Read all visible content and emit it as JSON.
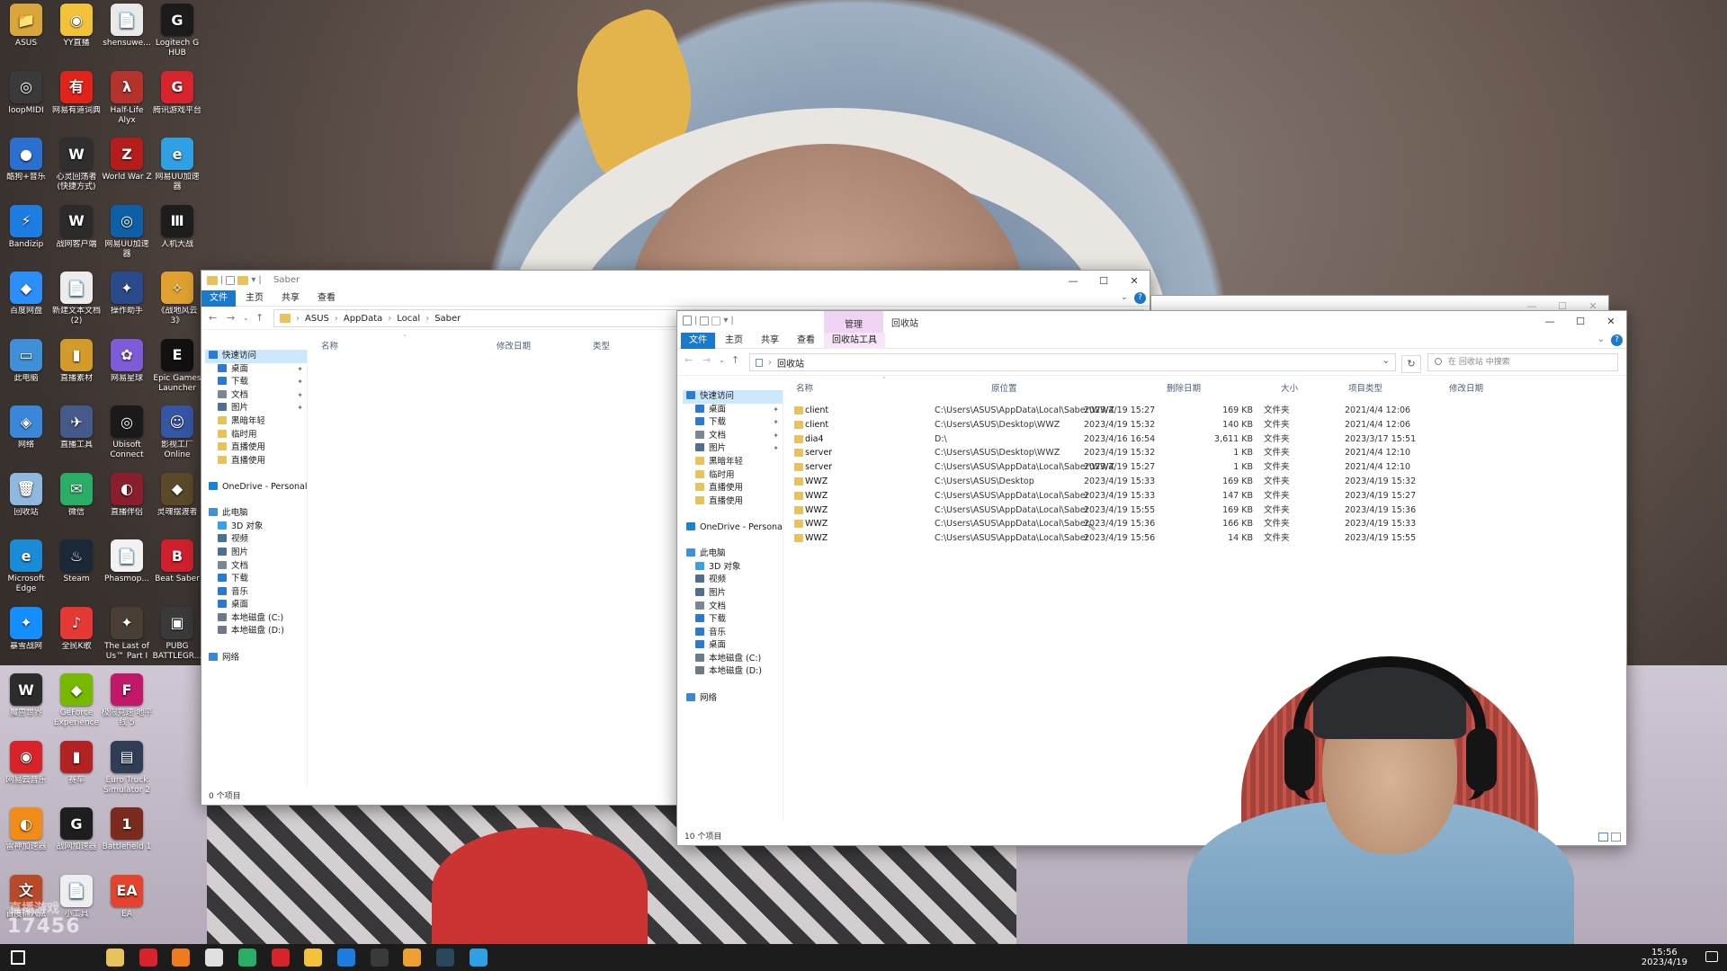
{
  "desktop": {
    "icons": [
      {
        "label": "ASUS",
        "glyph": "📁",
        "color": "#d9a63b"
      },
      {
        "label": "YY直播",
        "glyph": "◉",
        "color": "#f3c13a"
      },
      {
        "label": "shensuwe...",
        "glyph": "📄",
        "color": "#e9e9e9"
      },
      {
        "label": "Logitech G HUB",
        "glyph": "G",
        "color": "#1b1b1b"
      },
      {
        "label": "loopMIDI",
        "glyph": "◎",
        "color": "#3a3a3a"
      },
      {
        "label": "网易有道词典",
        "glyph": "有",
        "color": "#e2231a"
      },
      {
        "label": "Half-Life Alyx",
        "glyph": "λ",
        "color": "#b5332c"
      },
      {
        "label": "腾讯游戏平台",
        "glyph": "G",
        "color": "#d8242d"
      },
      {
        "label": "酷狗+音乐",
        "glyph": "●",
        "color": "#2b6fd1"
      },
      {
        "label": "心灵回荡者 (快捷方式)",
        "glyph": "W",
        "color": "#2f2f2f"
      },
      {
        "label": "World War Z",
        "glyph": "Z",
        "color": "#b51d1d"
      },
      {
        "label": "网易UU加速器",
        "glyph": "e",
        "color": "#2fa0e3"
      },
      {
        "label": "Bandizip",
        "glyph": "⚡",
        "color": "#1e7de2"
      },
      {
        "label": "战网客户端",
        "glyph": "W",
        "color": "#2b2b2b"
      },
      {
        "label": "网易UU加速器",
        "glyph": "◎",
        "color": "#0f5ea8"
      },
      {
        "label": "人机大战",
        "glyph": "Ⅲ",
        "color": "#1d1d1d"
      },
      {
        "label": "百度网盘",
        "glyph": "◆",
        "color": "#2c8ef8"
      },
      {
        "label": "新建文本文档 (2)",
        "glyph": "📄",
        "color": "#ececec"
      },
      {
        "label": "操作助手",
        "glyph": "✦",
        "color": "#2a4a8c"
      },
      {
        "label": "《战地风云 3》",
        "glyph": "✧",
        "color": "#e0a12e"
      },
      {
        "label": "此电脑",
        "glyph": "▭",
        "color": "#3f8fd9"
      },
      {
        "label": "直播素材",
        "glyph": "▮",
        "color": "#d39b2c"
      },
      {
        "label": "网易星球",
        "glyph": "✿",
        "color": "#7e5bd8"
      },
      {
        "label": "Epic Games Launcher",
        "glyph": "E",
        "color": "#111111"
      },
      {
        "label": "网络",
        "glyph": "◈",
        "color": "#3a86d8"
      },
      {
        "label": "直播工具",
        "glyph": "✈",
        "color": "#455a8a"
      },
      {
        "label": "Ubisoft Connect",
        "glyph": "◎",
        "color": "#1a1a1a"
      },
      {
        "label": "影视工厂 Online",
        "glyph": "☺",
        "color": "#3555a5"
      },
      {
        "label": "回收站",
        "glyph": "🗑",
        "color": "#8fb8e0"
      },
      {
        "label": "微信",
        "glyph": "✉",
        "color": "#2aae67"
      },
      {
        "label": "直播伴侣",
        "glyph": "◐",
        "color": "#8b1e2d"
      },
      {
        "label": "灵魂摆渡者",
        "glyph": "◆",
        "color": "#5a4a2a"
      },
      {
        "label": "Microsoft Edge",
        "glyph": "e",
        "color": "#1a8bd6"
      },
      {
        "label": "Steam",
        "glyph": "♨",
        "color": "#1b2838"
      },
      {
        "label": "Phasmop...",
        "glyph": "📄",
        "color": "#f2f2f2"
      },
      {
        "label": "Beat Saber",
        "glyph": "B",
        "color": "#d0202f"
      },
      {
        "label": "暴雪战网",
        "glyph": "✦",
        "color": "#148eff"
      },
      {
        "label": "全民K歌",
        "glyph": "♪",
        "color": "#e53935"
      },
      {
        "label": "The Last of Us™ Part I",
        "glyph": "✦",
        "color": "#4a3f35"
      },
      {
        "label": "PUBG BATTLEGR...",
        "glyph": "▣",
        "color": "#3a3a3a"
      },
      {
        "label": "魔兽世界",
        "glyph": "W",
        "color": "#2c2c2c"
      },
      {
        "label": "GeForce Experience",
        "glyph": "◆",
        "color": "#76b900"
      },
      {
        "label": "极限竞速 地平线 5",
        "glyph": "F",
        "color": "#c2186b"
      },
      {
        "label": "",
        "glyph": "",
        "color": "transparent"
      },
      {
        "label": "网易云音乐",
        "glyph": "◉",
        "color": "#d8232a"
      },
      {
        "label": "赛车",
        "glyph": "▮",
        "color": "#b32222"
      },
      {
        "label": "Euro Truck Simulator 2",
        "glyph": "▤",
        "color": "#2f3d55"
      },
      {
        "label": "",
        "glyph": "",
        "color": "transparent"
      },
      {
        "label": "雷神加速器",
        "glyph": "◐",
        "color": "#f18b1a"
      },
      {
        "label": "战网加速器",
        "glyph": "G",
        "color": "#1e1e1e"
      },
      {
        "label": "Battlefield 1",
        "glyph": "1",
        "color": "#7a2b1d"
      },
      {
        "label": "",
        "glyph": "",
        "color": "transparent"
      },
      {
        "label": "百度输入法",
        "glyph": "文",
        "color": "#b84a2a"
      },
      {
        "label": "小工具",
        "glyph": "📄",
        "color": "#eeeeee"
      },
      {
        "label": "EA",
        "glyph": "EA",
        "color": "#e4432d"
      }
    ]
  },
  "saber_window": {
    "title": "Saber",
    "ribbon": [
      "文件",
      "主页",
      "共享",
      "查看"
    ],
    "address": [
      "ASUS",
      "AppData",
      "Local",
      "Saber"
    ],
    "columns": [
      "名称",
      "修改日期",
      "类型"
    ],
    "nav": [
      {
        "label": "快速访问",
        "icon": "star-icon",
        "color": "#2a7ad8",
        "indent": 0,
        "sel": true,
        "pin": false
      },
      {
        "label": "桌面",
        "icon": "desktop-icon",
        "color": "#2b79d0",
        "indent": 1,
        "pin": true
      },
      {
        "label": "下载",
        "icon": "download-icon",
        "color": "#2b79d0",
        "indent": 1,
        "pin": true
      },
      {
        "label": "文档",
        "icon": "document-icon",
        "color": "#7a8795",
        "indent": 1,
        "pin": true
      },
      {
        "label": "图片",
        "icon": "pictures-icon",
        "color": "#4f6f90",
        "indent": 1,
        "pin": true
      },
      {
        "label": "黑暗年轻",
        "icon": "folder-icon",
        "color": "#e8c25a",
        "indent": 1,
        "pin": false
      },
      {
        "label": "临时用",
        "icon": "folder-icon",
        "color": "#e8c25a",
        "indent": 1,
        "pin": false
      },
      {
        "label": "直播使用",
        "icon": "folder-icon",
        "color": "#e8c25a",
        "indent": 1,
        "pin": false
      },
      {
        "label": "直播使用",
        "icon": "folder-icon",
        "color": "#e8c25a",
        "indent": 1,
        "pin": false
      },
      {
        "label": "",
        "icon": "",
        "color": "transparent",
        "indent": 0,
        "pin": false
      },
      {
        "label": "OneDrive - Personal",
        "icon": "cloud-icon",
        "color": "#1a80d8",
        "indent": 0,
        "pin": false
      },
      {
        "label": "",
        "icon": "",
        "color": "transparent",
        "indent": 0,
        "pin": false
      },
      {
        "label": "此电脑",
        "icon": "pc-icon",
        "color": "#3f8fd9",
        "indent": 0,
        "pin": false
      },
      {
        "label": "3D 对象",
        "icon": "3d-objects-icon",
        "color": "#3aa0e0",
        "indent": 1,
        "pin": false
      },
      {
        "label": "视频",
        "icon": "video-icon",
        "color": "#4f6f90",
        "indent": 1,
        "pin": false
      },
      {
        "label": "图片",
        "icon": "pictures-icon",
        "color": "#4f6f90",
        "indent": 1,
        "pin": false
      },
      {
        "label": "文档",
        "icon": "document-icon",
        "color": "#7a8795",
        "indent": 1,
        "pin": false
      },
      {
        "label": "下载",
        "icon": "download-icon",
        "color": "#2b79d0",
        "indent": 1,
        "pin": false
      },
      {
        "label": "音乐",
        "icon": "music-icon",
        "color": "#2b79d0",
        "indent": 1,
        "pin": false
      },
      {
        "label": "桌面",
        "icon": "desktop-icon",
        "color": "#2b79d0",
        "indent": 1,
        "pin": false
      },
      {
        "label": "本地磁盘 (C:)",
        "icon": "drive-icon",
        "color": "#6d7b89",
        "indent": 1,
        "pin": false
      },
      {
        "label": "本地磁盘 (D:)",
        "icon": "drive-icon",
        "color": "#6d7b89",
        "indent": 1,
        "pin": false
      },
      {
        "label": "",
        "icon": "",
        "color": "transparent",
        "indent": 0,
        "pin": false
      },
      {
        "label": "网络",
        "icon": "network-icon",
        "color": "#3a86d8",
        "indent": 0,
        "pin": false
      }
    ],
    "status": "0 个项目"
  },
  "recycle_window": {
    "title": "回收站",
    "manage_label": "管理",
    "ribbon": [
      "文件",
      "主页",
      "共享",
      "查看",
      "回收站工具"
    ],
    "address": "回收站",
    "search_placeholder": "在 回收站 中搜索",
    "columns": [
      "名称",
      "原位置",
      "删除日期",
      "大小",
      "项目类型",
      "修改日期"
    ],
    "rows": [
      {
        "name": "client",
        "orig": "C:\\Users\\ASUS\\AppData\\Local\\Saber\\WWZ",
        "deleted": "2023/4/19 15:27",
        "size": "169 KB",
        "type": "文件夹",
        "modified": "2021/4/4 12:06"
      },
      {
        "name": "client",
        "orig": "C:\\Users\\ASUS\\Desktop\\WWZ",
        "deleted": "2023/4/19 15:32",
        "size": "140 KB",
        "type": "文件夹",
        "modified": "2021/4/4 12:06"
      },
      {
        "name": "dia4",
        "orig": "D:\\",
        "deleted": "2023/4/16 16:54",
        "size": "3,611 KB",
        "type": "文件夹",
        "modified": "2023/3/17 15:51"
      },
      {
        "name": "server",
        "orig": "C:\\Users\\ASUS\\Desktop\\WWZ",
        "deleted": "2023/4/19 15:32",
        "size": "1 KB",
        "type": "文件夹",
        "modified": "2021/4/4 12:10"
      },
      {
        "name": "server",
        "orig": "C:\\Users\\ASUS\\AppData\\Local\\Saber\\WWZ",
        "deleted": "2023/4/19 15:27",
        "size": "1 KB",
        "type": "文件夹",
        "modified": "2021/4/4 12:10"
      },
      {
        "name": "WWZ",
        "orig": "C:\\Users\\ASUS\\Desktop",
        "deleted": "2023/4/19 15:33",
        "size": "169 KB",
        "type": "文件夹",
        "modified": "2023/4/19 15:32"
      },
      {
        "name": "WWZ",
        "orig": "C:\\Users\\ASUS\\AppData\\Local\\Saber",
        "deleted": "2023/4/19 15:33",
        "size": "147 KB",
        "type": "文件夹",
        "modified": "2023/4/19 15:27"
      },
      {
        "name": "WWZ",
        "orig": "C:\\Users\\ASUS\\AppData\\Local\\Saber",
        "deleted": "2023/4/19 15:55",
        "size": "169 KB",
        "type": "文件夹",
        "modified": "2023/4/19 15:36"
      },
      {
        "name": "WWZ",
        "orig": "C:\\Users\\ASUS\\AppData\\Local\\Saber",
        "deleted": "2023/4/19 15:36",
        "size": "166 KB",
        "type": "文件夹",
        "modified": "2023/4/19 15:33"
      },
      {
        "name": "WWZ",
        "orig": "C:\\Users\\ASUS\\AppData\\Local\\Saber",
        "deleted": "2023/4/19 15:56",
        "size": "14 KB",
        "type": "文件夹",
        "modified": "2023/4/19 15:55"
      }
    ],
    "nav": [
      {
        "label": "快速访问",
        "icon": "star-icon",
        "color": "#2a7ad8",
        "indent": 0,
        "sel": true,
        "pin": false
      },
      {
        "label": "桌面",
        "icon": "desktop-icon",
        "color": "#2b79d0",
        "indent": 1,
        "pin": true
      },
      {
        "label": "下载",
        "icon": "download-icon",
        "color": "#2b79d0",
        "indent": 1,
        "pin": true
      },
      {
        "label": "文档",
        "icon": "document-icon",
        "color": "#7a8795",
        "indent": 1,
        "pin": true
      },
      {
        "label": "图片",
        "icon": "pictures-icon",
        "color": "#4f6f90",
        "indent": 1,
        "pin": true
      },
      {
        "label": "黑暗年轻",
        "icon": "folder-icon",
        "color": "#e8c25a",
        "indent": 1,
        "pin": false
      },
      {
        "label": "临时用",
        "icon": "folder-icon",
        "color": "#e8c25a",
        "indent": 1,
        "pin": false
      },
      {
        "label": "直播使用",
        "icon": "folder-icon",
        "color": "#e8c25a",
        "indent": 1,
        "pin": false
      },
      {
        "label": "直播使用",
        "icon": "folder-icon",
        "color": "#e8c25a",
        "indent": 1,
        "pin": false
      },
      {
        "label": "",
        "icon": "",
        "color": "transparent",
        "indent": 0,
        "pin": false
      },
      {
        "label": "OneDrive - Personal",
        "icon": "cloud-icon",
        "color": "#1a80d8",
        "indent": 0,
        "pin": false
      },
      {
        "label": "",
        "icon": "",
        "color": "transparent",
        "indent": 0,
        "pin": false
      },
      {
        "label": "此电脑",
        "icon": "pc-icon",
        "color": "#3f8fd9",
        "indent": 0,
        "pin": false
      },
      {
        "label": "3D 对象",
        "icon": "3d-objects-icon",
        "color": "#3aa0e0",
        "indent": 1,
        "pin": false
      },
      {
        "label": "视频",
        "icon": "video-icon",
        "color": "#4f6f90",
        "indent": 1,
        "pin": false
      },
      {
        "label": "图片",
        "icon": "pictures-icon",
        "color": "#4f6f90",
        "indent": 1,
        "pin": false
      },
      {
        "label": "文档",
        "icon": "document-icon",
        "color": "#7a8795",
        "indent": 1,
        "pin": false
      },
      {
        "label": "下载",
        "icon": "download-icon",
        "color": "#2b79d0",
        "indent": 1,
        "pin": false
      },
      {
        "label": "音乐",
        "icon": "music-icon",
        "color": "#2b79d0",
        "indent": 1,
        "pin": false
      },
      {
        "label": "桌面",
        "icon": "desktop-icon",
        "color": "#2b79d0",
        "indent": 1,
        "pin": false
      },
      {
        "label": "本地磁盘 (C:)",
        "icon": "drive-icon",
        "color": "#6d7b89",
        "indent": 1,
        "pin": false
      },
      {
        "label": "本地磁盘 (D:)",
        "icon": "drive-icon",
        "color": "#6d7b89",
        "indent": 1,
        "pin": false
      },
      {
        "label": "",
        "icon": "",
        "color": "transparent",
        "indent": 0,
        "pin": false
      },
      {
        "label": "网络",
        "icon": "network-icon",
        "color": "#3a86d8",
        "indent": 0,
        "pin": false
      }
    ],
    "status": "10 个项目"
  },
  "taskbar": {
    "apps": [
      {
        "name": "file-explorer-icon",
        "color": "#e8c25a"
      },
      {
        "name": "netease-music-icon",
        "color": "#d8232a"
      },
      {
        "name": "firefox-icon",
        "color": "#f07a1c"
      },
      {
        "name": "mail-icon",
        "color": "#e0e0e0"
      },
      {
        "name": "wechat-icon",
        "color": "#2aae67"
      },
      {
        "name": "live-icon",
        "color": "#d8232a"
      },
      {
        "name": "yy-icon",
        "color": "#f3c13a"
      },
      {
        "name": "bandizip-icon",
        "color": "#1e7de2"
      },
      {
        "name": "obs-icon",
        "color": "#3a3a3a"
      },
      {
        "name": "notepad-icon",
        "color": "#f0a030"
      },
      {
        "name": "steam-icon",
        "color": "#2a475e"
      },
      {
        "name": "uu-icon",
        "color": "#2fa0e3"
      }
    ],
    "time": "15:56",
    "date": "2023/4/19"
  },
  "watermark": {
    "line1": "直播游戏",
    "line2": "17456"
  }
}
